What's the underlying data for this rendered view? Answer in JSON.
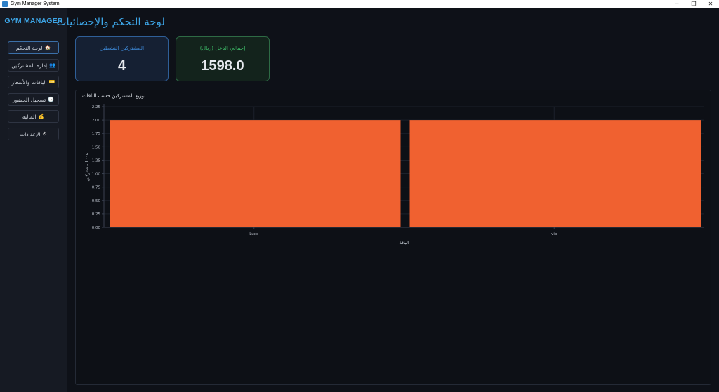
{
  "window": {
    "title": "Gym Manager System",
    "controls": {
      "minimize": "─",
      "restore": "❐",
      "close": "✕"
    }
  },
  "sidebar": {
    "brand": "GYM MANAGER",
    "items": [
      {
        "label": "لوحة التحكم",
        "icon": "home-icon",
        "glyph": "🏠",
        "active": true
      },
      {
        "label": "إدارة المشتركين",
        "icon": "users-icon",
        "glyph": "👥",
        "active": false
      },
      {
        "label": "الباقات والأسعار",
        "icon": "card-icon",
        "glyph": "💳",
        "active": false
      },
      {
        "label": "تسجيل الحضور",
        "icon": "clock-icon",
        "glyph": "🕒",
        "active": false
      },
      {
        "label": "المالية",
        "icon": "money-icon",
        "glyph": "💰",
        "active": false
      },
      {
        "label": "الإعدادات",
        "icon": "gear-icon",
        "glyph": "⚙",
        "active": false
      }
    ]
  },
  "main": {
    "title": "لوحة التحكم والإحصائيات",
    "cards": [
      {
        "label": "المشتركين النشطين",
        "value": "4",
        "color": "#3d88d6"
      },
      {
        "label": "إجمالي الدخل (ريال)",
        "value": "1598.0",
        "color": "#3fbf6a"
      }
    ]
  },
  "chart_data": {
    "type": "bar",
    "title": "توزيع المشتركين حسب الباقات",
    "xlabel": "الباقة",
    "ylabel": "عدد المشتركين",
    "categories": [
      "Luxe",
      "vip"
    ],
    "values": [
      2,
      2
    ],
    "ylim": [
      0,
      2.25
    ],
    "yticks": [
      "0.00",
      "0.25",
      "0.50",
      "0.75",
      "1.00",
      "1.25",
      "1.50",
      "1.75",
      "2.00",
      "2.25"
    ],
    "bar_color": "#f06130",
    "grid": true,
    "legend": "none"
  }
}
